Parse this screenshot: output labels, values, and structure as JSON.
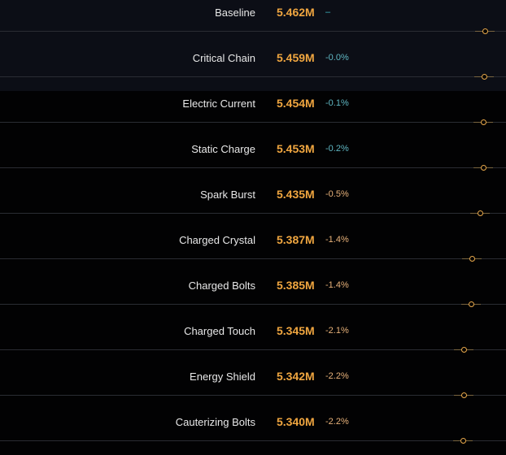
{
  "colors": {
    "background": "#020203",
    "value": "#f0a640",
    "delta_neutral": "#3fb6c2",
    "delta_negative": "#e8b27a",
    "marker": "#e8a84a"
  },
  "rows": [
    {
      "name": "Baseline",
      "value": "5.462M",
      "delta": "–",
      "kind": "neutral",
      "fraction": 1.0
    },
    {
      "name": "Critical Chain",
      "value": "5.459M",
      "delta": "-0.0%",
      "kind": "small",
      "fraction": 0.9995
    },
    {
      "name": "Electric Current",
      "value": "5.454M",
      "delta": "-0.1%",
      "kind": "small",
      "fraction": 0.9985
    },
    {
      "name": "Static Charge",
      "value": "5.453M",
      "delta": "-0.2%",
      "kind": "small",
      "fraction": 0.9984
    },
    {
      "name": "Spark Burst",
      "value": "5.435M",
      "delta": "-0.5%",
      "kind": "neg",
      "fraction": 0.9951
    },
    {
      "name": "Charged Crystal",
      "value": "5.387M",
      "delta": "-1.4%",
      "kind": "neg",
      "fraction": 0.9863
    },
    {
      "name": "Charged Bolts",
      "value": "5.385M",
      "delta": "-1.4%",
      "kind": "neg",
      "fraction": 0.9859
    },
    {
      "name": "Charged Touch",
      "value": "5.345M",
      "delta": "-2.1%",
      "kind": "neg",
      "fraction": 0.9786
    },
    {
      "name": "Energy Shield",
      "value": "5.342M",
      "delta": "-2.2%",
      "kind": "neg",
      "fraction": 0.978
    },
    {
      "name": "Cauterizing Bolts",
      "value": "5.340M",
      "delta": "-2.2%",
      "kind": "neg",
      "fraction": 0.9777
    }
  ]
}
